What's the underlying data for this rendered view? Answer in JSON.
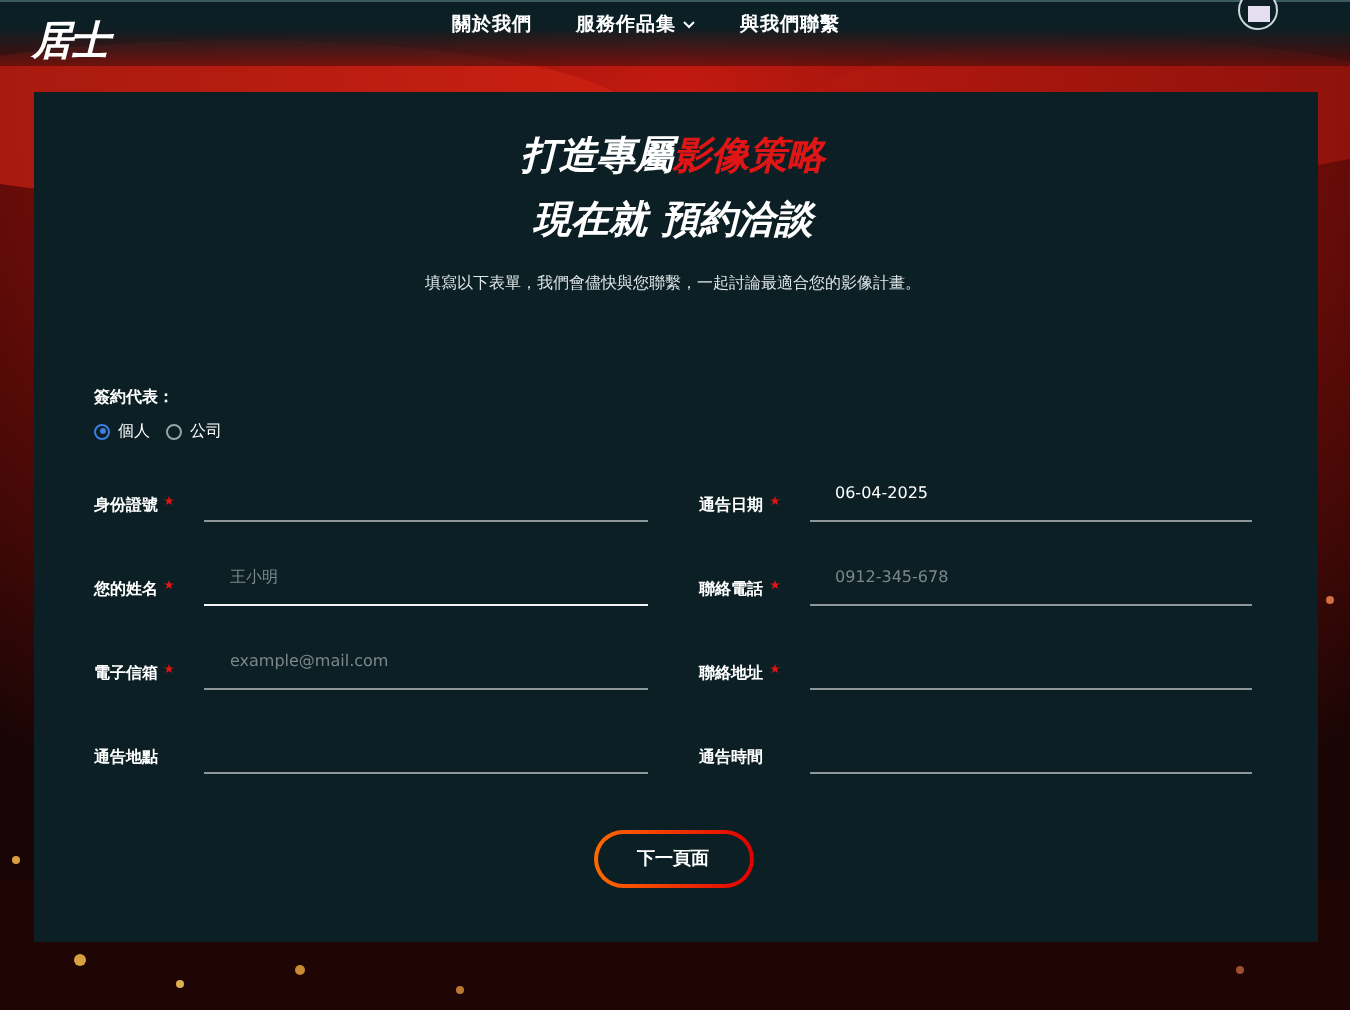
{
  "header": {
    "logo": "居士",
    "nav": [
      {
        "label": "關於我們",
        "dropdown": false
      },
      {
        "label": "服務作品集",
        "dropdown": true
      },
      {
        "label": "與我們聯繫",
        "dropdown": false
      }
    ]
  },
  "form": {
    "title_line_1": "打造專屬",
    "title_highlight": "影像策略",
    "title_line_2": "現在就 預約洽談",
    "intro": "填寫以下表單，我們會儘快與您聯繫，一起討論最適合您的影像計畫。",
    "signer": {
      "label": "簽約代表：",
      "options": [
        {
          "label": "個人",
          "selected": true
        },
        {
          "label": "公司",
          "selected": false
        }
      ]
    },
    "left_fields": [
      {
        "label": "身份證號",
        "required": true,
        "focused": false
      },
      {
        "label": "您的姓名",
        "required": true,
        "focused": true,
        "placeholder": "王小明"
      },
      {
        "label": "電子信箱",
        "required": true,
        "focused": false,
        "placeholder": "example@mail.com"
      },
      {
        "label": "通告地點",
        "required": false,
        "focused": false
      }
    ],
    "right_fields": [
      {
        "label": "通告日期",
        "required": true,
        "focused": false,
        "value": "06-04-2025"
      },
      {
        "label": "聯絡電話",
        "required": true,
        "focused": false,
        "placeholder": "0912-345-678"
      },
      {
        "label": "聯絡地址",
        "required": true,
        "focused": false
      },
      {
        "label": "通告時間",
        "required": false,
        "focused": false
      }
    ],
    "submit": "下一頁面"
  }
}
